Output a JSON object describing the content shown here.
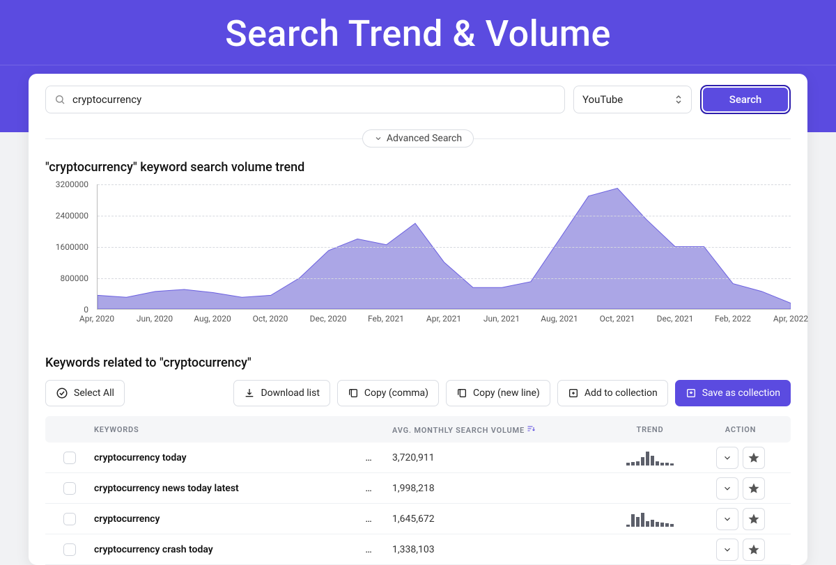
{
  "hero": {
    "title": "Search Trend & Volume"
  },
  "search": {
    "query": "cryptocurrency",
    "source_selected": "YouTube",
    "button": "Search",
    "advanced": "Advanced Search"
  },
  "chart_section_title": "\"cryptocurrency\" keyword search volume trend",
  "chart_data": {
    "type": "area",
    "title": "\"cryptocurrency\" keyword search volume trend",
    "xlabel": "",
    "ylabel": "",
    "ylim": [
      0,
      3200000
    ],
    "y_ticks": [
      "0",
      "800000",
      "1600000",
      "2400000",
      "3200000"
    ],
    "x_ticks": [
      "Apr, 2020",
      "Jun, 2020",
      "Aug, 2020",
      "Oct, 2020",
      "Dec, 2020",
      "Feb, 2021",
      "Apr, 2021",
      "Jun, 2021",
      "Aug, 2021",
      "Oct, 2021",
      "Dec, 2021",
      "Feb, 2022",
      "Apr, 2022"
    ],
    "categories": [
      "Apr 2020",
      "May 2020",
      "Jun 2020",
      "Jul 2020",
      "Aug 2020",
      "Sep 2020",
      "Oct 2020",
      "Nov 2020",
      "Dec 2020",
      "Jan 2021",
      "Feb 2021",
      "Mar 2021",
      "Apr 2021",
      "May 2021",
      "Jun 2021",
      "Jul 2021",
      "Aug 2021",
      "Sep 2021",
      "Oct 2021",
      "Nov 2021",
      "Dec 2021",
      "Jan 2022",
      "Feb 2022",
      "Mar 2022",
      "Apr 2022"
    ],
    "values": [
      350000,
      300000,
      450000,
      500000,
      420000,
      300000,
      350000,
      800000,
      1500000,
      1800000,
      1650000,
      2200000,
      1200000,
      550000,
      550000,
      700000,
      1800000,
      2900000,
      3100000,
      2300000,
      1600000,
      1600000,
      650000,
      450000,
      150000
    ]
  },
  "related": {
    "title": "Keywords related to \"cryptocurrency\"",
    "columns": {
      "keywords": "KEYWORDS",
      "volume": "AVG. MONTHLY SEARCH VOLUME",
      "trend": "TREND",
      "action": "ACTION"
    },
    "toolbar": {
      "select_all": "Select All",
      "download": "Download list",
      "copy_comma": "Copy (comma)",
      "copy_newline": "Copy (new line)",
      "add_collection": "Add to collection",
      "save_collection": "Save as collection"
    },
    "rows": [
      {
        "keyword": "cryptocurrency today",
        "volume": "3,720,911",
        "spark": [
          4,
          5,
          6,
          12,
          20,
          14,
          6,
          4,
          4,
          3
        ]
      },
      {
        "keyword": "cryptocurrency news today latest",
        "volume": "1,998,218",
        "spark": []
      },
      {
        "keyword": "cryptocurrency",
        "volume": "1,645,672",
        "spark": [
          3,
          18,
          14,
          20,
          8,
          10,
          7,
          6,
          5,
          4
        ]
      },
      {
        "keyword": "cryptocurrency crash today",
        "volume": "1,338,103",
        "spark": []
      }
    ]
  }
}
